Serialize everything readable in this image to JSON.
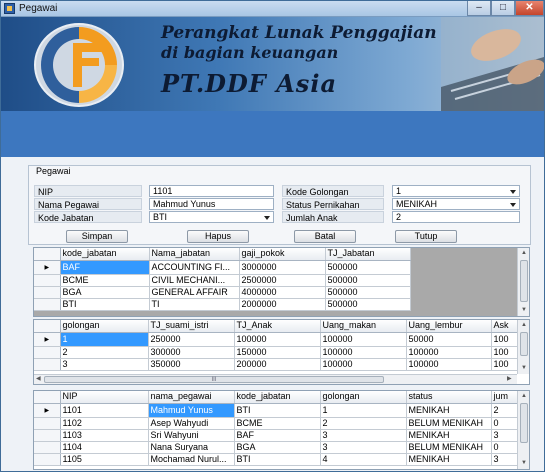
{
  "window": {
    "title": "Pegawai",
    "minimize_icon": "minimize-icon",
    "maximize_icon": "maximize-icon",
    "close_icon": "close-icon"
  },
  "banner": {
    "line1": "Perangkat Lunak Penggajian",
    "line2": "di bagian keuangan",
    "line3": "PT.DDF Asia"
  },
  "form": {
    "group_title": "Pegawai",
    "nip_label": "NIP",
    "nip_value": "1101",
    "nama_label": "Nama Pegawai",
    "nama_value": "Mahmud Yunus",
    "kode_jabatan_label": "Kode Jabatan",
    "kode_jabatan_value": "BTI",
    "kode_golongan_label": "Kode Golongan",
    "kode_golongan_value": "1",
    "status_label": "Status Pernikahan",
    "status_value": "MENIKAH",
    "jumlah_anak_label": "Jumlah Anak",
    "jumlah_anak_value": "2"
  },
  "buttons": {
    "simpan": "Simpan",
    "hapus": "Hapus",
    "batal": "Batal",
    "tutup": "Tutup"
  },
  "grid_jabatan": {
    "headers": [
      "kode_jabatan",
      "Nama_jabatan",
      "gaji_pokok",
      "TJ_Jabatan"
    ],
    "rows": [
      [
        "BAF",
        "ACCOUNTING FI...",
        "3000000",
        "500000"
      ],
      [
        "BCME",
        "CIVIL MECHANI...",
        "2500000",
        "500000"
      ],
      [
        "BGA",
        "GENERAL AFFAIR",
        "4000000",
        "500000"
      ],
      [
        "BTI",
        "TI",
        "2000000",
        "500000"
      ]
    ]
  },
  "grid_golongan": {
    "headers": [
      "golongan",
      "TJ_suami_istri",
      "TJ_Anak",
      "Uang_makan",
      "Uang_lembur",
      "Ask"
    ],
    "rows": [
      [
        "1",
        "250000",
        "100000",
        "100000",
        "50000",
        "100"
      ],
      [
        "2",
        "300000",
        "150000",
        "100000",
        "100000",
        "100"
      ],
      [
        "3",
        "350000",
        "200000",
        "100000",
        "100000",
        "100"
      ]
    ],
    "hscroll_thumb_label": "III"
  },
  "grid_pegawai": {
    "headers": [
      "NIP",
      "nama_pegawai",
      "kode_jabatan",
      "golongan",
      "status",
      "jum"
    ],
    "rows": [
      [
        "1101",
        "Mahmud Yunus",
        "BTI",
        "1",
        "MENIKAH",
        "2"
      ],
      [
        "1102",
        "Asep Wahyudi",
        "BCME",
        "2",
        "BELUM MENIKAH",
        "0"
      ],
      [
        "1103",
        "Sri Wahyuni",
        "BAF",
        "3",
        "MENIKAH",
        "3"
      ],
      [
        "1104",
        "Nana Suryana",
        "BGA",
        "3",
        "BELUM MENIKAH",
        "0"
      ],
      [
        "1105",
        "Mochamad Nurul...",
        "BTI",
        "4",
        "MENIKAH",
        "3"
      ]
    ]
  },
  "colors": {
    "selection": "#3399ff",
    "banner_dark": "#1f4d87",
    "band": "#3d77bf"
  }
}
